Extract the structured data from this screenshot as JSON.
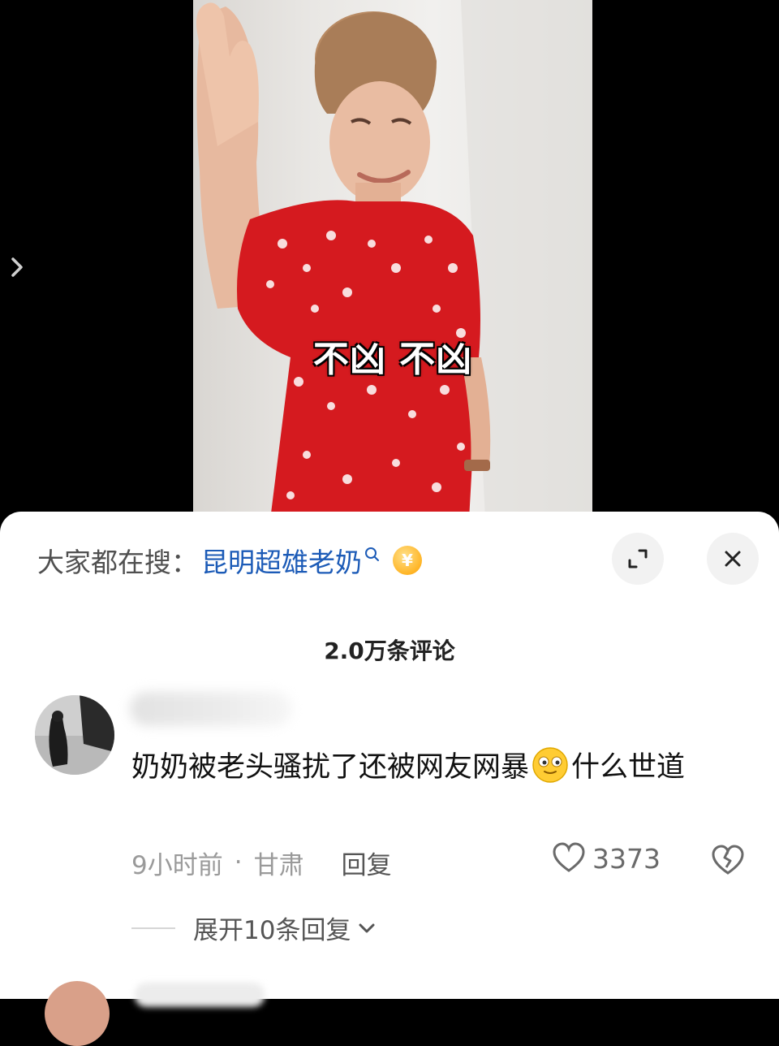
{
  "video": {
    "subtitle": "不凶 不凶"
  },
  "sheet": {
    "search_prefix": "大家都在搜：",
    "search_term": "昆明超雄老奶",
    "reward_symbol": "¥",
    "comment_count": "2.0万条评论"
  },
  "comment": {
    "text_part1": "奶奶被老头骚扰了还被网友网暴",
    "text_part2": "什么世道",
    "time": "9小时前",
    "location": "甘肃",
    "reply_label": "回复",
    "likes": "3373",
    "expand_replies": "展开10条回复"
  },
  "colors": {
    "link_blue": "#1c5bb7",
    "dress_red": "#d51a1f"
  },
  "icons": {
    "expand": "chevron-right-icon",
    "fullscreen": "expand-corner-icon",
    "close": "close-icon",
    "search": "search-icon",
    "reward": "coin-icon",
    "like": "heart-icon",
    "dislike": "broken-heart-icon",
    "expand_more": "chevron-down-icon"
  }
}
